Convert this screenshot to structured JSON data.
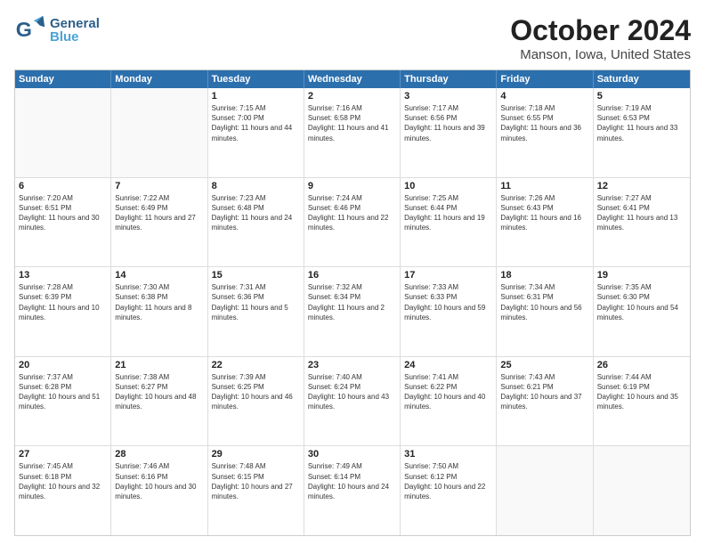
{
  "header": {
    "logo_general": "General",
    "logo_blue": "Blue",
    "title": "October 2024",
    "subtitle": "Manson, Iowa, United States"
  },
  "calendar": {
    "days_of_week": [
      "Sunday",
      "Monday",
      "Tuesday",
      "Wednesday",
      "Thursday",
      "Friday",
      "Saturday"
    ],
    "weeks": [
      [
        {
          "day": "",
          "info": "",
          "empty": true
        },
        {
          "day": "",
          "info": "",
          "empty": true
        },
        {
          "day": "1",
          "info": "Sunrise: 7:15 AM\nSunset: 7:00 PM\nDaylight: 11 hours and 44 minutes."
        },
        {
          "day": "2",
          "info": "Sunrise: 7:16 AM\nSunset: 6:58 PM\nDaylight: 11 hours and 41 minutes."
        },
        {
          "day": "3",
          "info": "Sunrise: 7:17 AM\nSunset: 6:56 PM\nDaylight: 11 hours and 39 minutes."
        },
        {
          "day": "4",
          "info": "Sunrise: 7:18 AM\nSunset: 6:55 PM\nDaylight: 11 hours and 36 minutes."
        },
        {
          "day": "5",
          "info": "Sunrise: 7:19 AM\nSunset: 6:53 PM\nDaylight: 11 hours and 33 minutes."
        }
      ],
      [
        {
          "day": "6",
          "info": "Sunrise: 7:20 AM\nSunset: 6:51 PM\nDaylight: 11 hours and 30 minutes."
        },
        {
          "day": "7",
          "info": "Sunrise: 7:22 AM\nSunset: 6:49 PM\nDaylight: 11 hours and 27 minutes."
        },
        {
          "day": "8",
          "info": "Sunrise: 7:23 AM\nSunset: 6:48 PM\nDaylight: 11 hours and 24 minutes."
        },
        {
          "day": "9",
          "info": "Sunrise: 7:24 AM\nSunset: 6:46 PM\nDaylight: 11 hours and 22 minutes."
        },
        {
          "day": "10",
          "info": "Sunrise: 7:25 AM\nSunset: 6:44 PM\nDaylight: 11 hours and 19 minutes."
        },
        {
          "day": "11",
          "info": "Sunrise: 7:26 AM\nSunset: 6:43 PM\nDaylight: 11 hours and 16 minutes."
        },
        {
          "day": "12",
          "info": "Sunrise: 7:27 AM\nSunset: 6:41 PM\nDaylight: 11 hours and 13 minutes."
        }
      ],
      [
        {
          "day": "13",
          "info": "Sunrise: 7:28 AM\nSunset: 6:39 PM\nDaylight: 11 hours and 10 minutes."
        },
        {
          "day": "14",
          "info": "Sunrise: 7:30 AM\nSunset: 6:38 PM\nDaylight: 11 hours and 8 minutes."
        },
        {
          "day": "15",
          "info": "Sunrise: 7:31 AM\nSunset: 6:36 PM\nDaylight: 11 hours and 5 minutes."
        },
        {
          "day": "16",
          "info": "Sunrise: 7:32 AM\nSunset: 6:34 PM\nDaylight: 11 hours and 2 minutes."
        },
        {
          "day": "17",
          "info": "Sunrise: 7:33 AM\nSunset: 6:33 PM\nDaylight: 10 hours and 59 minutes."
        },
        {
          "day": "18",
          "info": "Sunrise: 7:34 AM\nSunset: 6:31 PM\nDaylight: 10 hours and 56 minutes."
        },
        {
          "day": "19",
          "info": "Sunrise: 7:35 AM\nSunset: 6:30 PM\nDaylight: 10 hours and 54 minutes."
        }
      ],
      [
        {
          "day": "20",
          "info": "Sunrise: 7:37 AM\nSunset: 6:28 PM\nDaylight: 10 hours and 51 minutes."
        },
        {
          "day": "21",
          "info": "Sunrise: 7:38 AM\nSunset: 6:27 PM\nDaylight: 10 hours and 48 minutes."
        },
        {
          "day": "22",
          "info": "Sunrise: 7:39 AM\nSunset: 6:25 PM\nDaylight: 10 hours and 46 minutes."
        },
        {
          "day": "23",
          "info": "Sunrise: 7:40 AM\nSunset: 6:24 PM\nDaylight: 10 hours and 43 minutes."
        },
        {
          "day": "24",
          "info": "Sunrise: 7:41 AM\nSunset: 6:22 PM\nDaylight: 10 hours and 40 minutes."
        },
        {
          "day": "25",
          "info": "Sunrise: 7:43 AM\nSunset: 6:21 PM\nDaylight: 10 hours and 37 minutes."
        },
        {
          "day": "26",
          "info": "Sunrise: 7:44 AM\nSunset: 6:19 PM\nDaylight: 10 hours and 35 minutes."
        }
      ],
      [
        {
          "day": "27",
          "info": "Sunrise: 7:45 AM\nSunset: 6:18 PM\nDaylight: 10 hours and 32 minutes."
        },
        {
          "day": "28",
          "info": "Sunrise: 7:46 AM\nSunset: 6:16 PM\nDaylight: 10 hours and 30 minutes."
        },
        {
          "day": "29",
          "info": "Sunrise: 7:48 AM\nSunset: 6:15 PM\nDaylight: 10 hours and 27 minutes."
        },
        {
          "day": "30",
          "info": "Sunrise: 7:49 AM\nSunset: 6:14 PM\nDaylight: 10 hours and 24 minutes."
        },
        {
          "day": "31",
          "info": "Sunrise: 7:50 AM\nSunset: 6:12 PM\nDaylight: 10 hours and 22 minutes."
        },
        {
          "day": "",
          "info": "",
          "empty": true
        },
        {
          "day": "",
          "info": "",
          "empty": true
        }
      ]
    ]
  }
}
